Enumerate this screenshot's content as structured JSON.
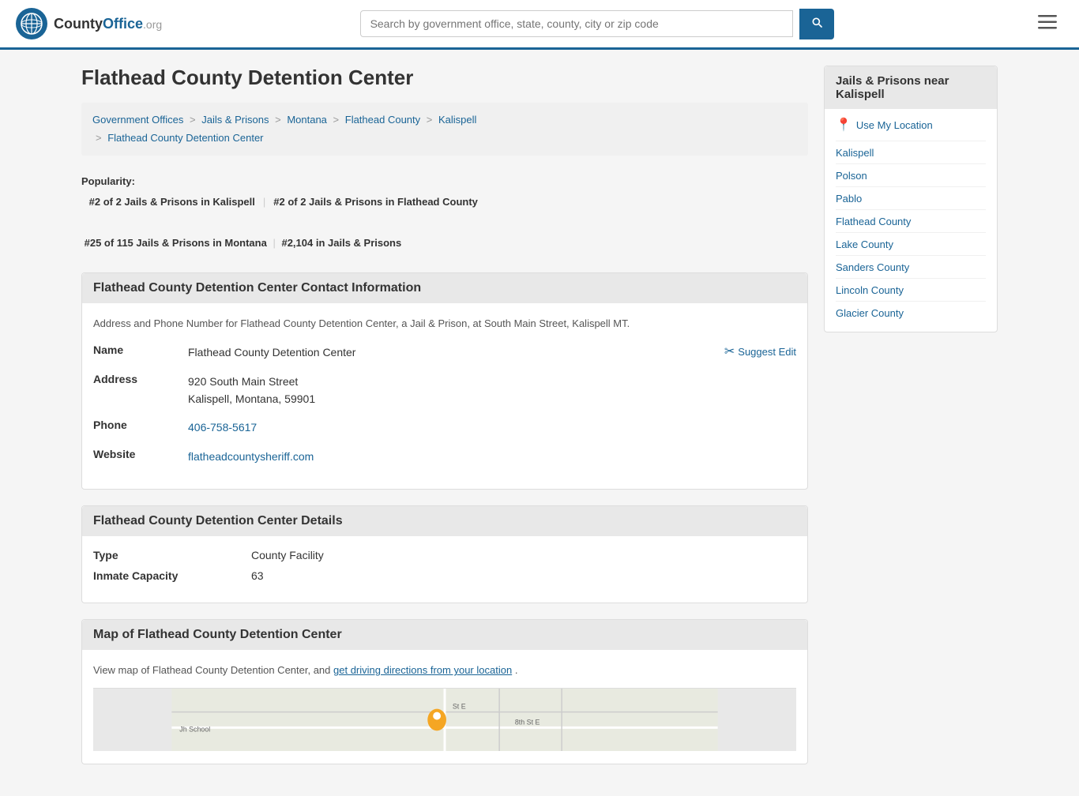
{
  "header": {
    "logo_text": "County",
    "logo_org": "Office.org",
    "search_placeholder": "Search by government office, state, county, city or zip code",
    "search_btn_label": "🔍"
  },
  "page": {
    "title": "Flathead County Detention Center"
  },
  "breadcrumb": {
    "items": [
      {
        "label": "Government Offices",
        "href": "#"
      },
      {
        "label": "Jails & Prisons",
        "href": "#"
      },
      {
        "label": "Montana",
        "href": "#"
      },
      {
        "label": "Flathead County",
        "href": "#"
      },
      {
        "label": "Kalispell",
        "href": "#"
      },
      {
        "label": "Flathead County Detention Center",
        "href": "#"
      }
    ]
  },
  "popularity": {
    "label": "Popularity:",
    "items": [
      "#2 of 2 Jails & Prisons in Kalispell",
      "#2 of 2 Jails & Prisons in Flathead County",
      "#25 of 115 Jails & Prisons in Montana",
      "#2,104 in Jails & Prisons"
    ]
  },
  "contact_section": {
    "header": "Flathead County Detention Center Contact Information",
    "desc": "Address and Phone Number for Flathead County Detention Center, a Jail & Prison, at South Main Street, Kalispell MT.",
    "name_label": "Name",
    "name_value": "Flathead County Detention Center",
    "address_label": "Address",
    "address_line1": "920 South Main Street",
    "address_line2": "Kalispell, Montana, 59901",
    "phone_label": "Phone",
    "phone_value": "406-758-5617",
    "website_label": "Website",
    "website_value": "flatheadcountysheriff.com",
    "suggest_edit": "Suggest Edit"
  },
  "details_section": {
    "header": "Flathead County Detention Center Details",
    "type_label": "Type",
    "type_value": "County Facility",
    "capacity_label": "Inmate Capacity",
    "capacity_value": "63"
  },
  "map_section": {
    "header": "Map of Flathead County Detention Center",
    "desc_start": "View map of Flathead County Detention Center, and ",
    "desc_link": "get driving directions from your location",
    "desc_end": "."
  },
  "sidebar": {
    "header_line1": "Jails & Prisons near",
    "header_line2": "Kalispell",
    "use_location": "Use My Location",
    "links": [
      {
        "label": "Kalispell",
        "href": "#"
      },
      {
        "label": "Polson",
        "href": "#"
      },
      {
        "label": "Pablo",
        "href": "#"
      },
      {
        "label": "Flathead County",
        "href": "#"
      },
      {
        "label": "Lake County",
        "href": "#"
      },
      {
        "label": "Sanders County",
        "href": "#"
      },
      {
        "label": "Lincoln County",
        "href": "#"
      },
      {
        "label": "Glacier County",
        "href": "#"
      }
    ]
  }
}
